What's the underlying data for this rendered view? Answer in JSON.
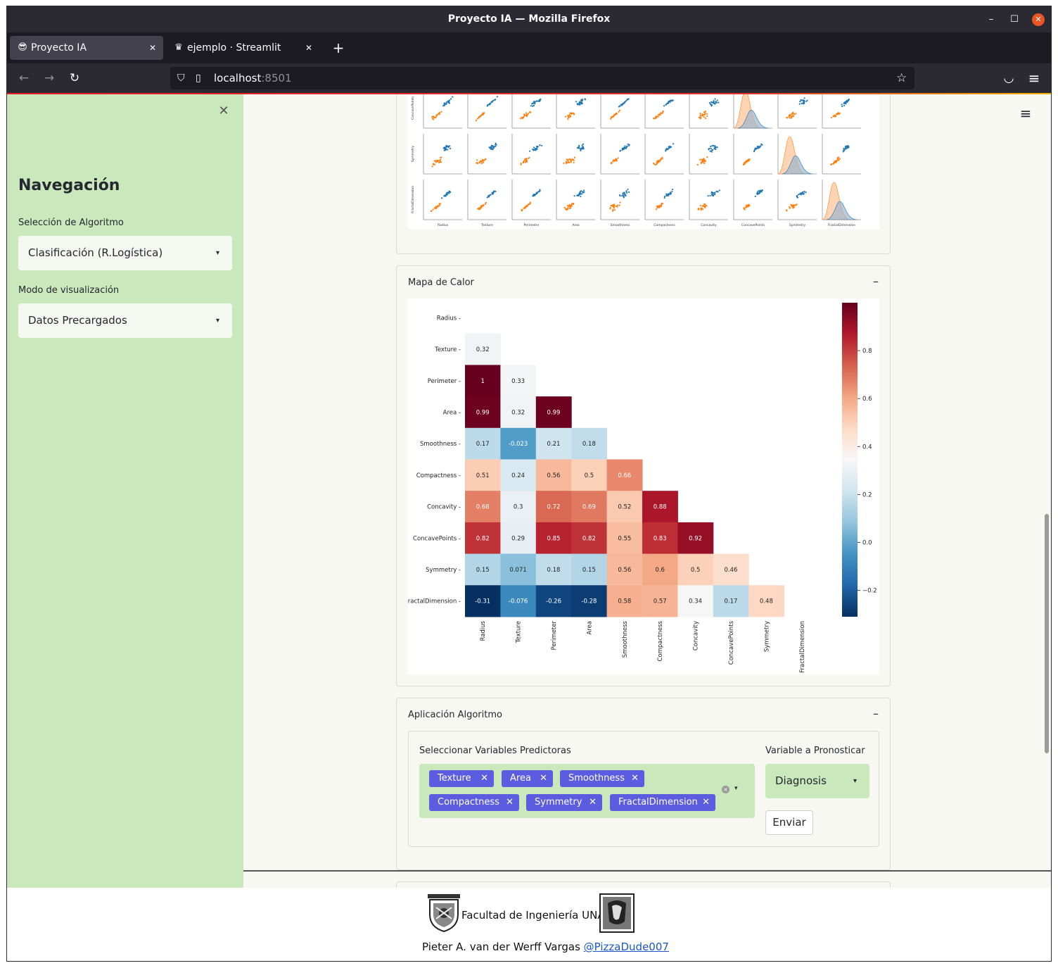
{
  "window": {
    "title": "Proyecto IA — Mozilla Firefox",
    "minimize": "–",
    "maximize": "☐",
    "close": "✕"
  },
  "tabs": [
    {
      "icon": "😎",
      "label": "Proyecto IA",
      "close": "✕"
    },
    {
      "icon": "♛",
      "label": "ejemplo · Streamlit",
      "close": "✕"
    }
  ],
  "new_tab": "+",
  "nav": {
    "back": "←",
    "forward": "→",
    "reload": "↻",
    "url_host": "localhost",
    "url_port": ":8501",
    "shield": "⛉",
    "page": "▯",
    "bookmark": "☆",
    "pocket": "◡",
    "menu": "≡"
  },
  "sidebar": {
    "close": "✕",
    "heading": "Navegación",
    "algo_label": "Selección de Algoritmo",
    "algo_value": "Clasificación (R.Logística)",
    "mode_label": "Modo de visualización",
    "mode_value": "Datos Precargados",
    "caret": "▾"
  },
  "app_menu": "≡",
  "pairplot": {
    "y_labels": [
      "ConcavePoints",
      "Symmetry",
      "FractalDimension"
    ],
    "x_labels": [
      "Radius",
      "Texture",
      "Perimeter",
      "Area",
      "Smoothness",
      "Compactness",
      "Concavity",
      "ConcavePoints",
      "Symmetry",
      "FractalDimension"
    ],
    "colors": {
      "blue": "#1f77b4",
      "orange": "#ff7f0e"
    }
  },
  "heatmap_section": {
    "title": "Mapa de Calor",
    "toggle": "–"
  },
  "chart_data": {
    "type": "heatmap",
    "title": "",
    "labels": [
      "Radius",
      "Texture",
      "Perimeter",
      "Area",
      "Smoothness",
      "Compactness",
      "Concavity",
      "ConcavePoints",
      "Symmetry",
      "FractalDimension"
    ],
    "values": [
      [],
      [
        0.32
      ],
      [
        1,
        0.33
      ],
      [
        0.99,
        0.32,
        0.99
      ],
      [
        0.17,
        -0.023,
        0.21,
        0.18
      ],
      [
        0.51,
        0.24,
        0.56,
        0.5,
        0.66
      ],
      [
        0.68,
        0.3,
        0.72,
        0.69,
        0.52,
        0.88
      ],
      [
        0.82,
        0.29,
        0.85,
        0.82,
        0.55,
        0.83,
        0.92
      ],
      [
        0.15,
        0.071,
        0.18,
        0.15,
        0.56,
        0.6,
        0.5,
        0.46
      ],
      [
        -0.31,
        -0.076,
        -0.26,
        -0.28,
        0.58,
        0.57,
        0.34,
        0.17,
        0.48
      ]
    ],
    "value_labels": [
      [],
      [
        "0.32"
      ],
      [
        "1",
        "0.33"
      ],
      [
        "0.99",
        "0.32",
        "0.99"
      ],
      [
        "0.17",
        "-0.023",
        "0.21",
        "0.18"
      ],
      [
        "0.51",
        "0.24",
        "0.56",
        "0.5",
        "0.66"
      ],
      [
        "0.68",
        "0.3",
        "0.72",
        "0.69",
        "0.52",
        "0.88"
      ],
      [
        "0.82",
        "0.29",
        "0.85",
        "0.82",
        "0.55",
        "0.83",
        "0.92"
      ],
      [
        "0.15",
        "0.071",
        "0.18",
        "0.15",
        "0.56",
        "0.6",
        "0.5",
        "0.46"
      ],
      [
        "-0.31",
        "-0.076",
        "-0.26",
        "-0.28",
        "0.58",
        "0.57",
        "0.34",
        "0.17",
        "0.48"
      ]
    ],
    "colorbar": {
      "range": [
        -0.31,
        1
      ],
      "ticks": [
        0.8,
        0.6,
        0.4,
        0.2,
        0.0,
        -0.2
      ],
      "tick_labels": [
        "0.8",
        "0.6",
        "0.4",
        "0.2",
        "0.0",
        "−0.2"
      ],
      "colormap": "RdBu_r"
    },
    "grid": false,
    "legend": "colorbar-right"
  },
  "algo_section": {
    "title": "Aplicación Algoritmo",
    "toggle": "–",
    "predictors_label": "Seleccionar Variables Predictoras",
    "predictors": [
      "Texture",
      "Area",
      "Smoothness",
      "Compactness",
      "Symmetry",
      "FractalDimension"
    ],
    "chip_close": "✕",
    "clear": "×",
    "caret": "▾",
    "target_label": "Variable a Pronosticar",
    "target_value": "Diagnosis",
    "submit": "Enviar"
  },
  "footer": {
    "institution": "Facultad de Ingeniería UNAM",
    "author": "Pieter A. van der Werff Vargas",
    "handle": "@PizzaDude007"
  }
}
